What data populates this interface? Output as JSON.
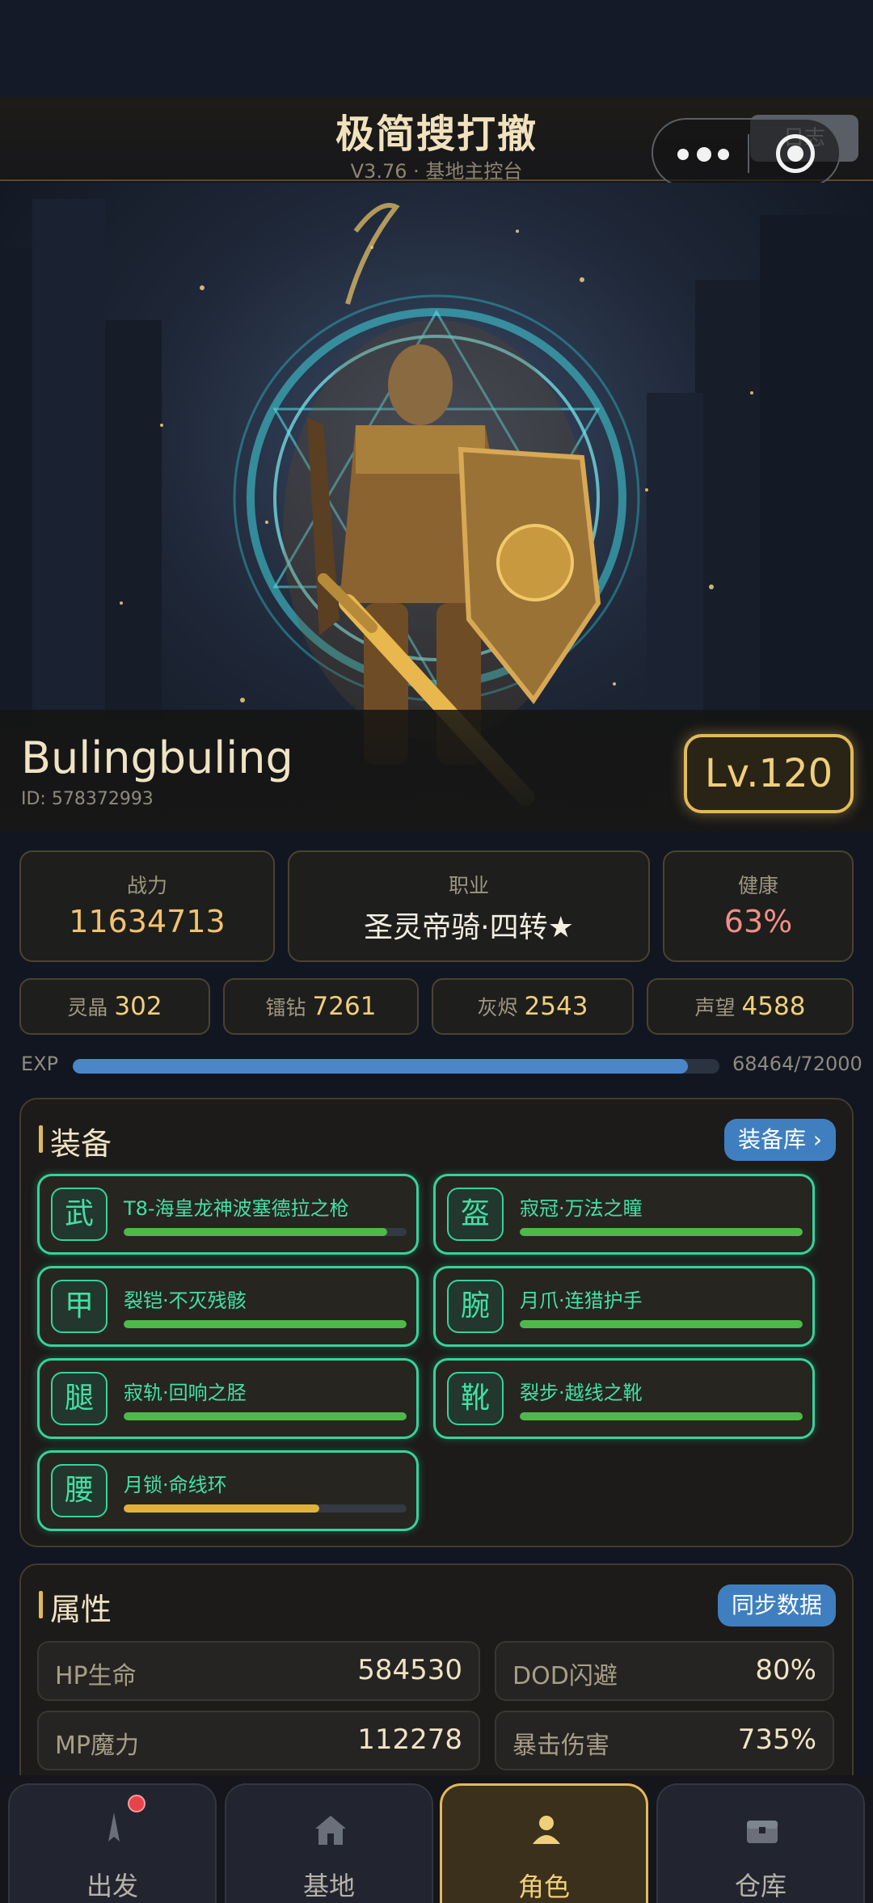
{
  "header": {
    "title": "极简搜打撤",
    "subtitle": "V3.76 · 基地主控台",
    "log_chip": "日志"
  },
  "player": {
    "name": "Bulingbuling",
    "id_text": "ID: 578372993",
    "level": "Lv.120"
  },
  "stats": [
    {
      "label": "战力",
      "value": "11634713",
      "color": "#f2c26d"
    },
    {
      "label": "职业",
      "value": "圣灵帝骑·四转★",
      "color": "#f3eee2"
    },
    {
      "label": "健康",
      "value": "63%",
      "color": "#f08f86"
    }
  ],
  "resources": [
    {
      "label": "灵晶",
      "value": "302"
    },
    {
      "label": "镭钻",
      "value": "7261"
    },
    {
      "label": "灰烬",
      "value": "2543"
    },
    {
      "label": "声望",
      "value": "4588"
    }
  ],
  "exp": {
    "label": "EXP",
    "value_text": "68464/72000",
    "fraction": 0.951
  },
  "equipment": {
    "title": "装备",
    "button": "装备库 ›",
    "items": [
      {
        "glyph": "武",
        "name": "T8-海皇龙神波塞德拉之枪",
        "durability": 0.93,
        "color": "#4fb84a"
      },
      {
        "glyph": "盔",
        "name": "寂冠·万法之瞳",
        "durability": 1.0,
        "color": "#4fb84a"
      },
      {
        "glyph": "甲",
        "name": "裂铠·不灭残骸",
        "durability": 1.0,
        "color": "#4fb84a"
      },
      {
        "glyph": "腕",
        "name": "月爪·连猎护手",
        "durability": 1.0,
        "color": "#4fb84a"
      },
      {
        "glyph": "腿",
        "name": "寂轨·回响之胫",
        "durability": 1.0,
        "color": "#4fb84a"
      },
      {
        "glyph": "靴",
        "name": "裂步·越线之靴",
        "durability": 1.0,
        "color": "#4fb84a"
      },
      {
        "glyph": "腰",
        "name": "月锁·命线环",
        "durability": 0.69,
        "color": "#e0b23a"
      }
    ]
  },
  "attributes": {
    "title": "属性",
    "button": "同步数据",
    "items": [
      {
        "label": "HP生命",
        "value": "584530"
      },
      {
        "label": "DOD闪避",
        "value": "80%"
      },
      {
        "label": "MP魔力",
        "value": "112278"
      },
      {
        "label": "暴击伤害",
        "value": "735%"
      }
    ]
  },
  "nav": [
    {
      "label": "出发",
      "icon": "rocket-icon"
    },
    {
      "label": "基地",
      "icon": "base-house-icon"
    },
    {
      "label": "角色",
      "icon": "character-icon"
    },
    {
      "label": "仓库",
      "icon": "storage-chest-icon"
    }
  ]
}
